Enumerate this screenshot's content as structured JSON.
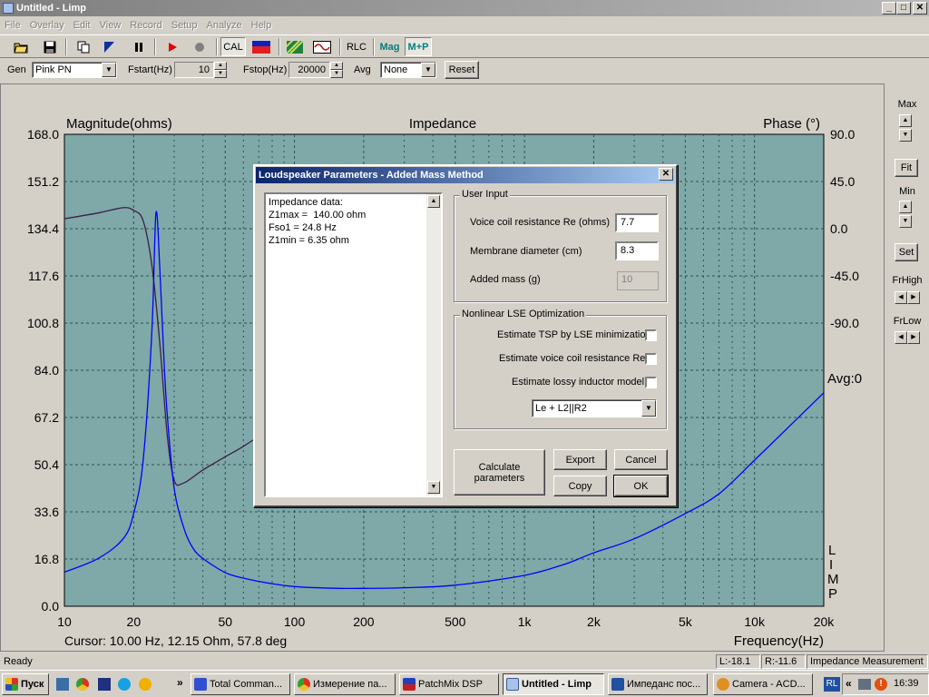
{
  "window": {
    "title": "Untitled - Limp",
    "min": "_",
    "max": "□",
    "close": "✕"
  },
  "menu": [
    "File",
    "Overlay",
    "Edit",
    "View",
    "Record",
    "Setup",
    "Analyze",
    "Help"
  ],
  "toolbar": {
    "cal": "CAL",
    "rlc": "RLC",
    "mag": "Mag",
    "mp": "M+P"
  },
  "genbar": {
    "gen_label": "Gen",
    "gen_value": "Pink PN",
    "fstart_label": "Fstart(Hz)",
    "fstart_value": "10",
    "fstop_label": "Fstop(Hz)",
    "fstop_value": "20000",
    "avg_label": "Avg",
    "avg_value": "None",
    "reset": "Reset"
  },
  "plot": {
    "left_title": "Magnitude(ohms)",
    "center_title": "Impedance",
    "right_title": "Phase (°)",
    "left_ticks": [
      "168.0",
      "151.2",
      "134.4",
      "117.6",
      "100.8",
      "84.0",
      "67.2",
      "50.4",
      "33.6",
      "16.8",
      "0.0"
    ],
    "right_ticks": [
      "90.0",
      "45.0",
      "0.0",
      "-45.0",
      "-90.0"
    ],
    "avg": "Avg:0",
    "x_ticks": [
      "10",
      "20",
      "50",
      "100",
      "200",
      "500",
      "1k",
      "2k",
      "5k",
      "10k",
      "20k"
    ],
    "x_title": "Frequency(Hz)",
    "limp": [
      "L",
      "I",
      "M",
      "P"
    ],
    "cursor": "Cursor: 10.00 Hz, 12.15 Ohm, 57.8 deg",
    "colors": {
      "background": "#7fa8a8",
      "magnitude": "#0000ff",
      "phase": "#3c1e46",
      "grid": "#305050"
    }
  },
  "chart_data": {
    "type": "line",
    "title": "Impedance",
    "xlabel": "Frequency(Hz)",
    "ylabel": "Magnitude(ohms)",
    "y2label": "Phase (°)",
    "xscale": "log",
    "xlim": [
      10,
      20000
    ],
    "ylim": [
      0,
      168
    ],
    "y2lim": [
      -90,
      90
    ],
    "grid": true,
    "series": [
      {
        "axis": "left",
        "x": [
          10,
          14,
          18,
          20,
          22,
          24,
          25,
          26,
          27,
          28,
          30,
          33,
          36,
          40,
          50,
          60,
          80,
          100,
          150,
          200,
          300,
          500,
          1000,
          1500,
          2000,
          3000,
          5000,
          7000,
          10000,
          15000,
          20000
        ],
        "y": [
          12.15,
          17,
          24,
          33,
          52,
          98,
          140,
          120,
          90,
          68,
          42,
          28,
          21,
          17,
          12,
          10,
          8,
          7,
          6.4,
          6.35,
          6.6,
          7.5,
          11,
          15,
          19,
          24,
          33,
          40,
          52,
          66,
          76
        ]
      },
      {
        "axis": "right",
        "x": [
          10,
          14,
          18,
          20,
          22,
          24,
          26,
          28,
          30,
          33,
          40,
          50,
          60,
          80,
          100
        ],
        "y": [
          57.8,
          60,
          62,
          61,
          57,
          40,
          10,
          -25,
          -42,
          -43,
          -38,
          -33,
          -29,
          -22,
          -18
        ]
      }
    ]
  },
  "right_panel": {
    "max": "Max",
    "fit": "Fit",
    "min": "Min",
    "set": "Set",
    "frhigh": "FrHigh",
    "frlow": "FrLow"
  },
  "status": {
    "ready": "Ready",
    "l": "L:-18.1",
    "r": "R:-11.6",
    "mode": "Impedance Measurement"
  },
  "taskbar": {
    "start": "Пуск",
    "tasks": [
      "Total Comman...",
      "Измерение па...",
      "PatchMix DSP",
      "Untitled - Limp",
      "Импеданс пос...",
      "Camera - ACD..."
    ],
    "lang": "RL",
    "clock": "16:39"
  },
  "dialog": {
    "title": "Loudspeaker Parameters - Added Mass Method",
    "close": "✕",
    "memo": "Impedance data:\nZ1max =  140.00 ohm\nFso1 = 24.8 Hz\nZ1min = 6.35 ohm",
    "user_input": {
      "title": "User Input",
      "re_label": "Voice coil resistance Re (ohms)",
      "re_value": "7.7",
      "diam_label": "Membrane diameter (cm)",
      "diam_value": "8.3",
      "mass_label": "Added mass (g)",
      "mass_value": "10"
    },
    "nonlinear": {
      "title": "Nonlinear LSE Optimization",
      "opt1": "Estimate TSP by LSE minimization",
      "opt2": "Estimate voice coil resistance Re",
      "opt3": "Estimate lossy inductor model",
      "model": "Le + L2||R2"
    },
    "buttons": {
      "calculate": "Calculate parameters",
      "export": "Export",
      "cancel": "Cancel",
      "copy": "Copy",
      "ok": "OK"
    }
  }
}
